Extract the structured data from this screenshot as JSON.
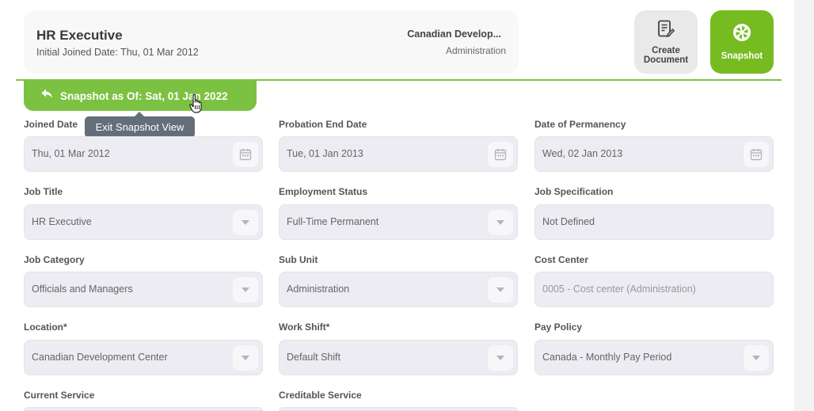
{
  "employee": {
    "name": "HR Executive",
    "joined": "Initial Joined Date: Thu, 01 Mar 2012",
    "location": "Canadian Develop...",
    "department": "Administration"
  },
  "actions": {
    "create_label": "Create Document",
    "snapshot_label": "Snapshot"
  },
  "snapshot": {
    "banner": "Snapshot as Of: Sat, 01 Jan 2022",
    "tooltip": "Exit Snapshot View"
  },
  "fields": {
    "joined_date": {
      "label": "Joined Date",
      "value": "Thu, 01 Mar 2012"
    },
    "probation_end": {
      "label": "Probation End Date",
      "value": "Tue, 01 Jan 2013"
    },
    "permanency": {
      "label": "Date of Permanency",
      "value": "Wed, 02 Jan 2013"
    },
    "job_title": {
      "label": "Job Title",
      "value": "HR Executive"
    },
    "employment_status": {
      "label": "Employment Status",
      "value": "Full-Time Permanent"
    },
    "job_spec": {
      "label": "Job Specification",
      "value": "Not Defined"
    },
    "job_category": {
      "label": "Job Category",
      "value": "Officials and Managers"
    },
    "sub_unit": {
      "label": "Sub Unit",
      "value": "Administration"
    },
    "cost_center": {
      "label": "Cost Center",
      "value": "0005 - Cost center (Administration)"
    },
    "location": {
      "label": "Location*",
      "value": "Canadian Development Center"
    },
    "work_shift": {
      "label": "Work Shift*",
      "value": "Default Shift"
    },
    "pay_policy": {
      "label": "Pay Policy",
      "value": "Canada - Monthly Pay Period"
    },
    "current_service": {
      "label": "Current Service"
    },
    "creditable_service": {
      "label": "Creditable Service"
    }
  },
  "colors": {
    "accent": "#76bc21",
    "banner": "#7cc242",
    "tooltip": "#646e7a"
  },
  "icons": {
    "calendar": "calendar-icon",
    "dropdown": "chevron-down-icon",
    "document": "document-edit-icon",
    "snapshot": "aperture-icon",
    "back": "reply-arrow-icon"
  }
}
